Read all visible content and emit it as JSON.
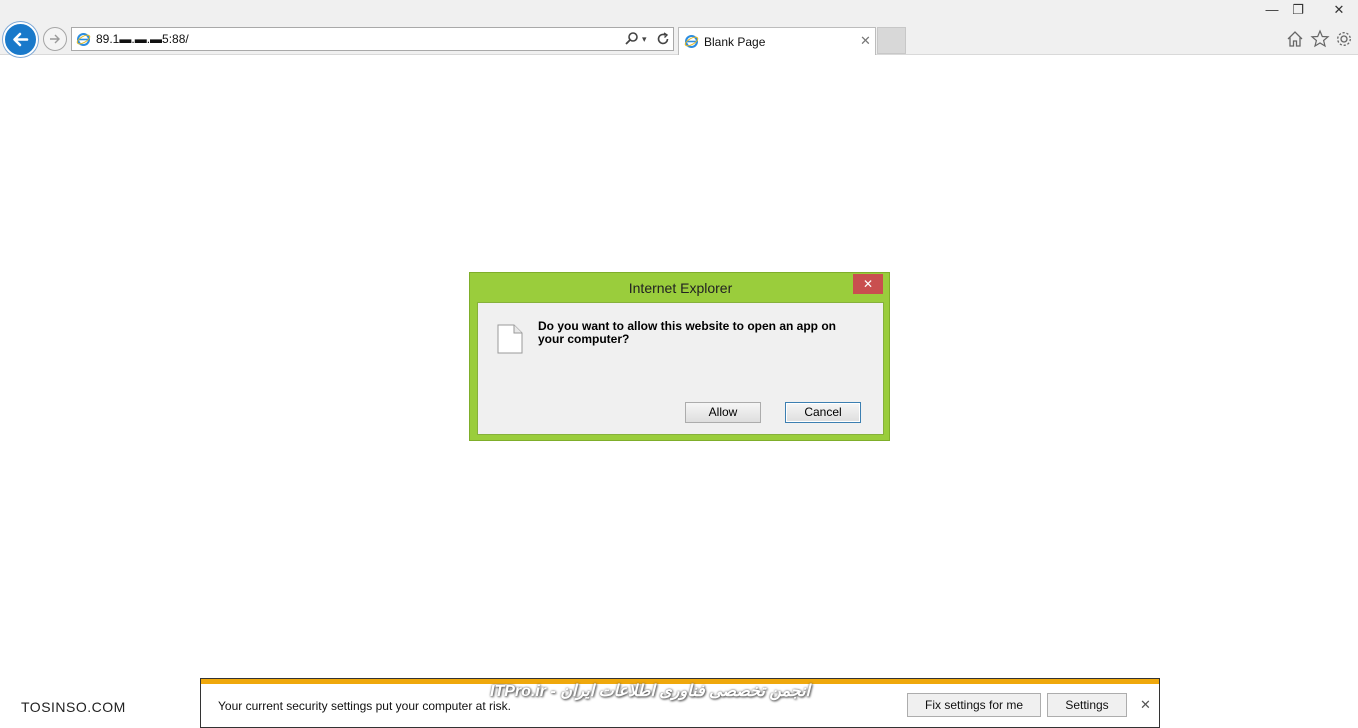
{
  "window": {
    "minimize_glyph": "—",
    "restore_glyph": "❐",
    "close_glyph": "✕"
  },
  "toolbar": {
    "back_icon": "back-arrow-icon",
    "forward_icon": "forward-arrow-icon",
    "address": "89.1▬.▬.▬5:88/",
    "tab_title": "Blank Page",
    "tab_close_glyph": "✕",
    "dropdown_glyph": "▾",
    "icons": [
      "search-icon",
      "refresh-icon",
      "home-icon",
      "favorites-star-icon",
      "gear-icon"
    ],
    "back_button_color": "#1979ca"
  },
  "dialog": {
    "title": "Internet Explorer",
    "close_glyph": "✕",
    "message": "Do you want to allow this website to open an app on your computer?",
    "buttons": {
      "allow": "Allow",
      "cancel": "Cancel"
    },
    "frame_color": "#9acd3c",
    "close_color": "#c94f4f"
  },
  "notification": {
    "message": "Your current security settings put your computer at risk.",
    "fix_button": "Fix settings for me",
    "settings_button": "Settings",
    "close_glyph": "✕",
    "accent_color": "#efa80c"
  },
  "watermarks": {
    "left": "TOSINSO.COM",
    "center": "ITPro.ir - انجمن تخصصی فناوری اطلاعات ایران"
  }
}
